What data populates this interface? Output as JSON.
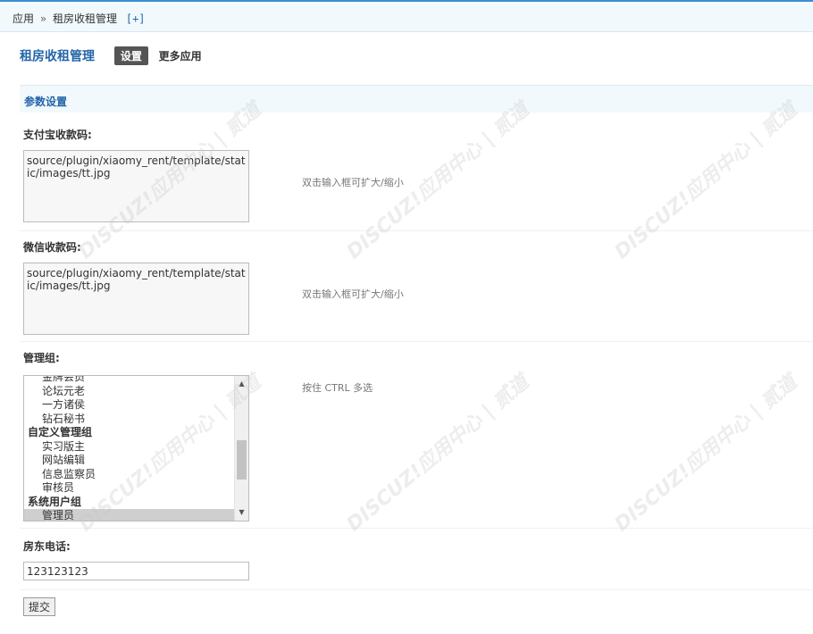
{
  "breadcrumb": {
    "root": "应用",
    "separator": "»",
    "current": "租房收租管理",
    "add": "[+]"
  },
  "header": {
    "title": "租房收租管理",
    "tab_settings": "设置",
    "tab_more": "更多应用"
  },
  "section": {
    "title": "参数设置"
  },
  "fields": {
    "alipay": {
      "label": "支付宝收款码:",
      "value": "source/plugin/xiaomy_rent/template/static/images/tt.jpg",
      "tip": "双击输入框可扩大/缩小"
    },
    "wechat": {
      "label": "微信收款码:",
      "value": "source/plugin/xiaomy_rent/template/static/images/tt.jpg",
      "tip": "双击输入框可扩大/缩小"
    },
    "admin_group": {
      "label": "管理组:",
      "tip": "按住 CTRL 多选",
      "options": [
        {
          "text": "金牌会员",
          "group": false,
          "selected": false
        },
        {
          "text": "论坛元老",
          "group": false,
          "selected": false
        },
        {
          "text": "一方诸侯",
          "group": false,
          "selected": false
        },
        {
          "text": "钻石秘书",
          "group": false,
          "selected": false
        },
        {
          "text": "自定义管理组",
          "group": true,
          "selected": false
        },
        {
          "text": "实习版主",
          "group": false,
          "selected": false
        },
        {
          "text": "网站编辑",
          "group": false,
          "selected": false
        },
        {
          "text": "信息监察员",
          "group": false,
          "selected": false
        },
        {
          "text": "审核员",
          "group": false,
          "selected": false
        },
        {
          "text": "系统用户组",
          "group": true,
          "selected": false
        },
        {
          "text": "管理员",
          "group": false,
          "selected": true
        }
      ]
    },
    "phone": {
      "label": "房东电话:",
      "value": "123123123"
    }
  },
  "submit": {
    "label": "提交"
  },
  "watermark": {
    "text": "DISCUZ!应用中心 | 贰道"
  }
}
